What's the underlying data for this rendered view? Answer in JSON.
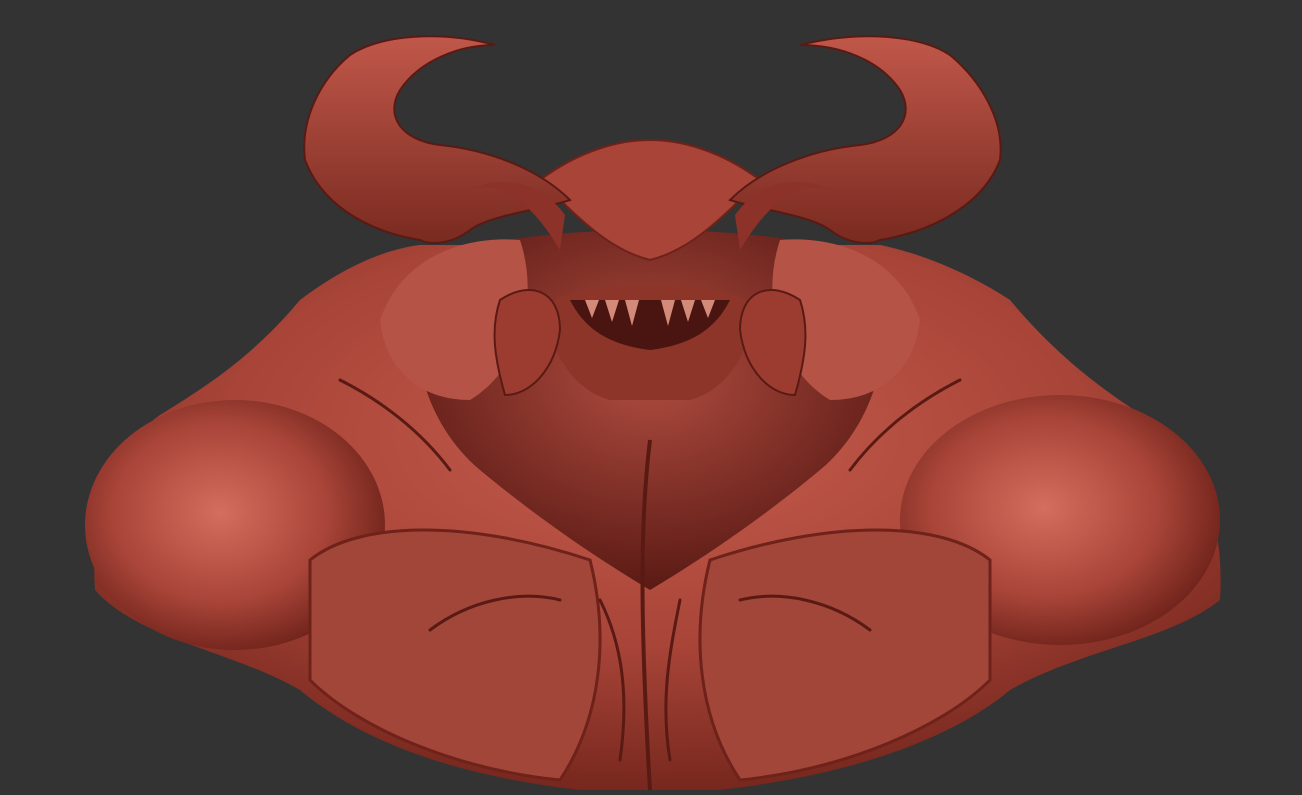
{
  "canvas": {
    "background": "#333333",
    "material_base": "#a84438",
    "material_highlight": "#d97a6a",
    "material_shadow": "#5a1a14"
  },
  "subject": {
    "icon": "demon-bust-sculpt"
  }
}
